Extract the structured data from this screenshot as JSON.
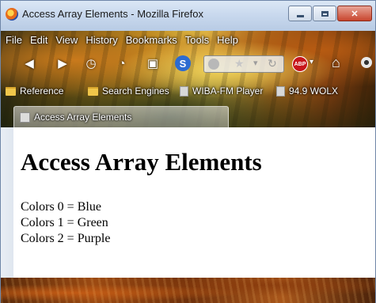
{
  "window": {
    "title": "Access Array Elements - Mozilla Firefox"
  },
  "menubar": {
    "items": [
      "File",
      "Edit",
      "View",
      "History",
      "Bookmarks",
      "Tools",
      "Help"
    ]
  },
  "navbar": {
    "icons": [
      "back-icon",
      "forward-icon",
      "history-icon",
      "rss-icon",
      "addon-icon",
      "s-addon-icon",
      "globe-icon",
      "star-icon",
      "reload-icon",
      "adblock-icon",
      "home-icon",
      "eye-icon"
    ],
    "adblock_label": "ABP",
    "s_addon_label": "S"
  },
  "bookmarks": {
    "items": [
      "Reference",
      "Search Engines",
      "WIBA-FM Player",
      "94.9 WOLX"
    ]
  },
  "tabs": [
    {
      "label": "Access Array Elements"
    }
  ],
  "page": {
    "heading": "Access Array Elements",
    "lines": [
      "Colors 0 = Blue",
      "Colors 1 = Green",
      "Colors 2 = Purple"
    ]
  }
}
